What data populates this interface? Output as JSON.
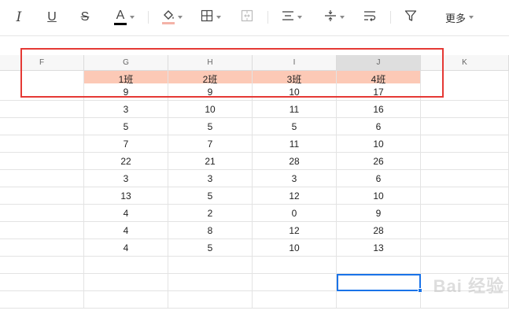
{
  "toolbar": {
    "buttons": [
      {
        "name": "italic-button",
        "icon": "italic-icon",
        "glyph": "I"
      },
      {
        "name": "underline-button",
        "icon": "underline-icon",
        "glyph": "U"
      },
      {
        "name": "strikethrough-button",
        "icon": "strikethrough-icon",
        "glyph": "S"
      },
      {
        "name": "font-color-button",
        "icon": "font-color-icon",
        "glyph": "A"
      },
      {
        "name": "fill-color-button",
        "icon": "paint-bucket-icon"
      },
      {
        "name": "borders-button",
        "icon": "border-grid-icon"
      },
      {
        "name": "merge-cells-button",
        "icon": "merge-icon"
      },
      {
        "name": "horizontal-align-button",
        "icon": "align-center-icon"
      },
      {
        "name": "vertical-align-button",
        "icon": "vertical-align-icon"
      },
      {
        "name": "wrap-text-button",
        "icon": "wrap-text-icon"
      },
      {
        "name": "filter-button",
        "icon": "filter-icon"
      }
    ],
    "more_label": "更多",
    "font_color": "#000000",
    "fill_color": "#f4b3a8"
  },
  "sheet": {
    "columns": [
      "F",
      "G",
      "H",
      "I",
      "J",
      "K"
    ],
    "selected_column": "J",
    "header_row": [
      "",
      "1班",
      "2班",
      "3班",
      "4班",
      ""
    ],
    "header_fill": "#fcc9b6",
    "rows": [
      [
        "",
        "9",
        "9",
        "10",
        "17",
        ""
      ],
      [
        "",
        "3",
        "10",
        "11",
        "16",
        ""
      ],
      [
        "",
        "5",
        "5",
        "5",
        "6",
        ""
      ],
      [
        "",
        "7",
        "7",
        "11",
        "10",
        ""
      ],
      [
        "",
        "22",
        "21",
        "28",
        "26",
        ""
      ],
      [
        "",
        "3",
        "3",
        "3",
        "6",
        ""
      ],
      [
        "",
        "13",
        "5",
        "12",
        "10",
        ""
      ],
      [
        "",
        "4",
        "2",
        "0",
        "9",
        ""
      ],
      [
        "",
        "4",
        "8",
        "12",
        "28",
        ""
      ],
      [
        "",
        "4",
        "5",
        "10",
        "13",
        ""
      ],
      [
        "",
        "",
        "",
        "",
        "",
        ""
      ],
      [
        "",
        "",
        "",
        "",
        "",
        ""
      ],
      [
        "",
        "",
        "",
        "",
        "",
        ""
      ]
    ],
    "accent_color": "#1a73e8",
    "callout_color": "#e53935"
  },
  "watermark": "Bai 经验"
}
